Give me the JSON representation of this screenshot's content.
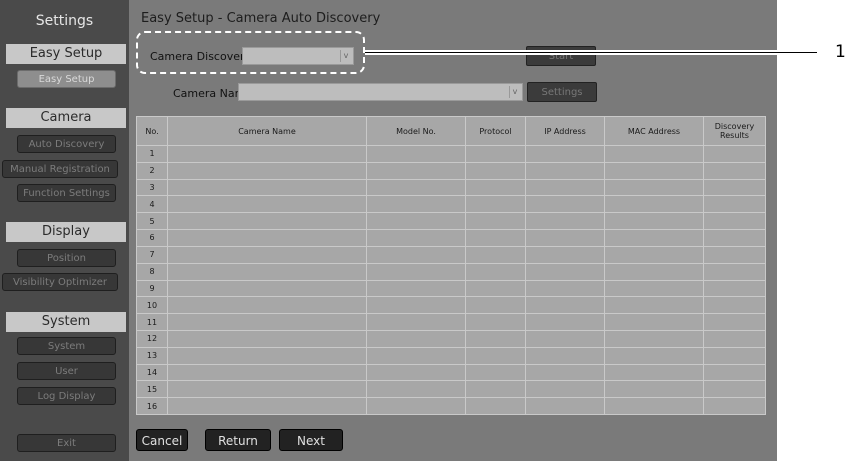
{
  "sidebar": {
    "title": "Settings",
    "sections": [
      {
        "header": "Easy Setup",
        "items": [
          {
            "label": "Easy Setup",
            "active": true
          }
        ]
      },
      {
        "header": "Camera",
        "items": [
          {
            "label": "Auto Discovery"
          },
          {
            "label": "Manual Registration"
          },
          {
            "label": "Function Settings"
          }
        ]
      },
      {
        "header": "Display",
        "items": [
          {
            "label": "Position"
          },
          {
            "label": "Visibility Optimizer"
          }
        ]
      },
      {
        "header": "System",
        "items": [
          {
            "label": "System"
          },
          {
            "label": "User"
          },
          {
            "label": "Log Display"
          }
        ]
      }
    ],
    "exit_label": "Exit"
  },
  "main": {
    "title": "Easy Setup - Camera Auto Discovery",
    "camera_discovery_label": "Camera Discovery",
    "camera_discovery_value": "",
    "start_label": "Start",
    "camera_name_label": "Camera Name",
    "camera_name_value": "",
    "settings_label": "Settings",
    "table": {
      "headers": [
        "No.",
        "Camera Name",
        "Model No.",
        "Protocol",
        "IP Address",
        "MAC Address",
        "Discovery Results"
      ],
      "rows": [
        "1",
        "2",
        "3",
        "4",
        "5",
        "6",
        "7",
        "8",
        "9",
        "10",
        "11",
        "12",
        "13",
        "14",
        "15",
        "16"
      ]
    },
    "buttons": {
      "cancel": "Cancel",
      "return": "Return",
      "next": "Next"
    }
  },
  "callout": {
    "number": "1"
  },
  "colors": {
    "screen_bg": "#7a7a7a",
    "sidebar_bg": "#4a4a4a",
    "section_header": "#c8c8c8",
    "callout_border": "#ffffff"
  }
}
